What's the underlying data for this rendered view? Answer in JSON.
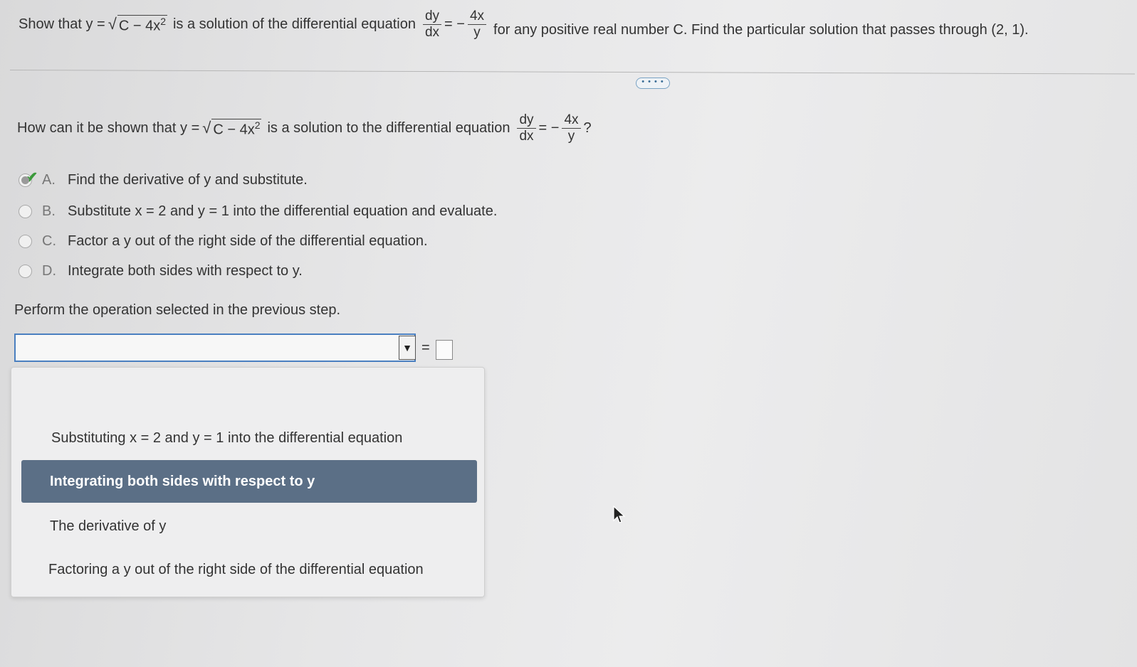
{
  "question": {
    "prefix": "Show that y =",
    "radicand": "C − 4x",
    "exp": "2",
    "mid": "is a solution of the differential equation",
    "dy": "dy",
    "dx": "dx",
    "eq": "= −",
    "num": "4x",
    "den": "y",
    "suffix": "for any positive real number C. Find the particular solution that passes through (2, 1)."
  },
  "more_label": "• • • •",
  "step_question": {
    "prefix": "How can it be shown that y =",
    "radicand": "C − 4x",
    "exp": "2",
    "mid": "is a solution to the differential equation",
    "dy": "dy",
    "dx": "dx",
    "eq": "= −",
    "num": "4x",
    "den": "y",
    "end": "?"
  },
  "options": [
    {
      "letter": "A.",
      "text": "Find the derivative of y and substitute.",
      "selected": true
    },
    {
      "letter": "B.",
      "text": "Substitute x = 2 and y = 1 into the differential equation and evaluate.",
      "selected": false
    },
    {
      "letter": "C.",
      "text": "Factor a y out of the right side of the differential equation.",
      "selected": false
    },
    {
      "letter": "D.",
      "text": "Integrate both sides with respect to y.",
      "selected": false
    }
  ],
  "perform_prompt": "Perform the operation selected in the previous step.",
  "select": {
    "value": "",
    "arrow": "▼",
    "equals": "="
  },
  "dropdown_items": [
    "Substituting x = 2 and y = 1 into the differential equation",
    "Integrating both sides with respect to y",
    "The derivative of y",
    "Factoring a y out of the right side of the differential equation"
  ],
  "dropdown_highlighted": "Integrating both sides with respect to y",
  "colors": {
    "accent": "#4a7fc0",
    "highlight": "#5b6f86",
    "check": "#3b9a3b"
  }
}
